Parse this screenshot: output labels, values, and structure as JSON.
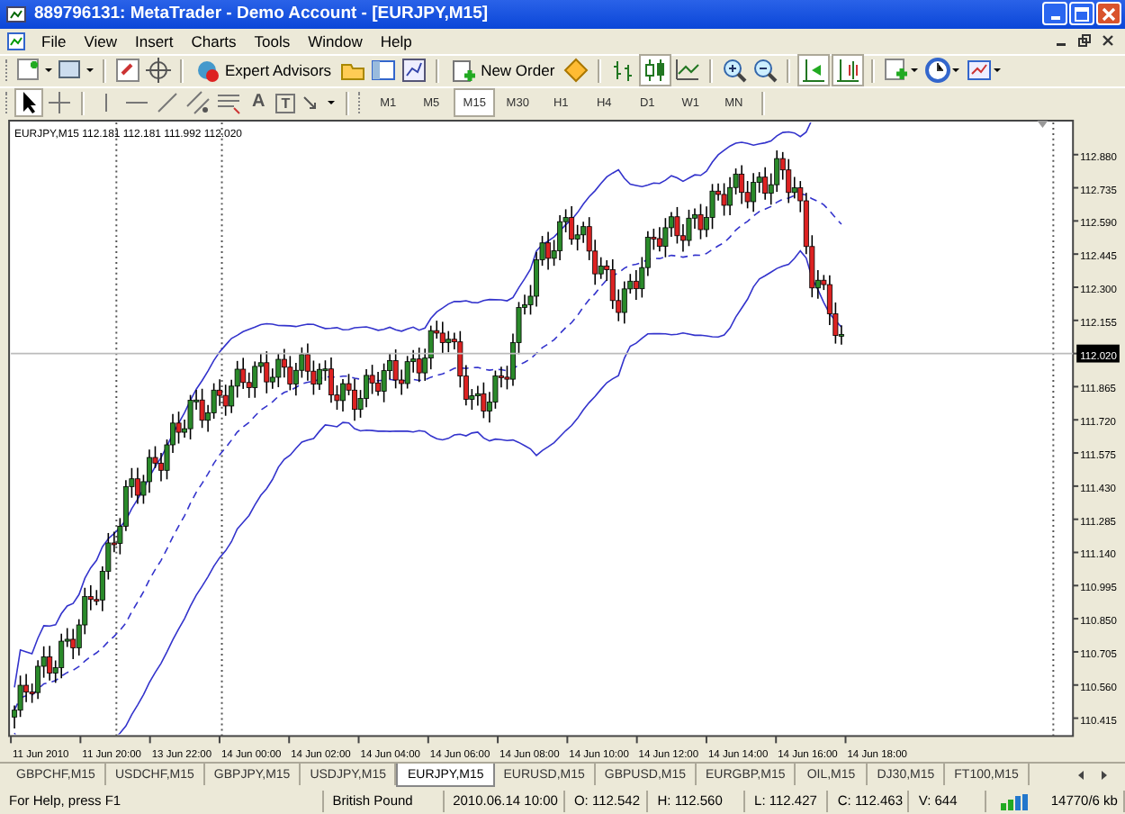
{
  "window": {
    "title": "889796131: MetaTrader - Demo Account - [EURJPY,M15]"
  },
  "menu": [
    "File",
    "View",
    "Insert",
    "Charts",
    "Tools",
    "Window",
    "Help"
  ],
  "toolbar": {
    "expert_advisors": "Expert Advisors",
    "new_order": "New Order"
  },
  "drawing_tools": {
    "text_tool": "A",
    "label_tool": "T"
  },
  "timeframes": [
    {
      "label": "M1",
      "selected": false
    },
    {
      "label": "M5",
      "selected": false
    },
    {
      "label": "M15",
      "selected": true
    },
    {
      "label": "M30",
      "selected": false
    },
    {
      "label": "H1",
      "selected": false
    },
    {
      "label": "H4",
      "selected": false
    },
    {
      "label": "D1",
      "selected": false
    },
    {
      "label": "W1",
      "selected": false
    },
    {
      "label": "MN",
      "selected": false
    }
  ],
  "chart": {
    "header": "EURJPY,M15  112.181 112.181 111.992 112.020",
    "price_axis": [
      {
        "text": "112.880",
        "kind": "tick"
      },
      {
        "text": "112.735",
        "kind": "tick"
      },
      {
        "text": "112.590",
        "kind": "tick"
      },
      {
        "text": "112.445",
        "kind": "tick"
      },
      {
        "text": "112.300",
        "kind": "tick"
      },
      {
        "text": "112.155",
        "kind": "tick"
      },
      {
        "text": "112.020",
        "kind": "current"
      },
      {
        "text": "111.865",
        "kind": "tick"
      },
      {
        "text": "111.720",
        "kind": "tick"
      },
      {
        "text": "111.575",
        "kind": "tick"
      },
      {
        "text": "111.430",
        "kind": "tick"
      },
      {
        "text": "111.285",
        "kind": "tick"
      },
      {
        "text": "111.140",
        "kind": "tick"
      },
      {
        "text": "110.995",
        "kind": "tick"
      },
      {
        "text": "110.850",
        "kind": "tick"
      },
      {
        "text": "110.705",
        "kind": "tick"
      },
      {
        "text": "110.560",
        "kind": "tick"
      },
      {
        "text": "110.415",
        "kind": "tick"
      }
    ],
    "time_axis": [
      "11 Jun 2010",
      "11 Jun 20:00",
      "13 Jun 22:00",
      "14 Jun 00:00",
      "14 Jun 02:00",
      "14 Jun 04:00",
      "14 Jun 06:00",
      "14 Jun 08:00",
      "14 Jun 10:00",
      "14 Jun 12:00",
      "14 Jun 14:00",
      "14 Jun 16:00",
      "14 Jun 18:00"
    ]
  },
  "symbol_tabs": [
    {
      "label": "GBPCHF,M15",
      "selected": false
    },
    {
      "label": "USDCHF,M15",
      "selected": false
    },
    {
      "label": "GBPJPY,M15",
      "selected": false
    },
    {
      "label": "USDJPY,M15",
      "selected": false
    },
    {
      "label": "EURJPY,M15",
      "selected": true
    },
    {
      "label": "EURUSD,M15",
      "selected": false
    },
    {
      "label": "GBPUSD,M15",
      "selected": false
    },
    {
      "label": "EURGBP,M15",
      "selected": false
    },
    {
      "label": "OIL,M15",
      "selected": false
    },
    {
      "label": "DJ30,M15",
      "selected": false
    },
    {
      "label": "FT100,M15",
      "selected": false
    }
  ],
  "status_bar": {
    "help": "For Help, press F1",
    "symbol": "British Pound",
    "time": "2010.06.14 10:00",
    "open": "O: 112.542",
    "high": "H: 112.560",
    "low": "L: 112.427",
    "close": "C: 112.463",
    "volume": "V: 644",
    "traffic": "14770/6 kb"
  }
}
